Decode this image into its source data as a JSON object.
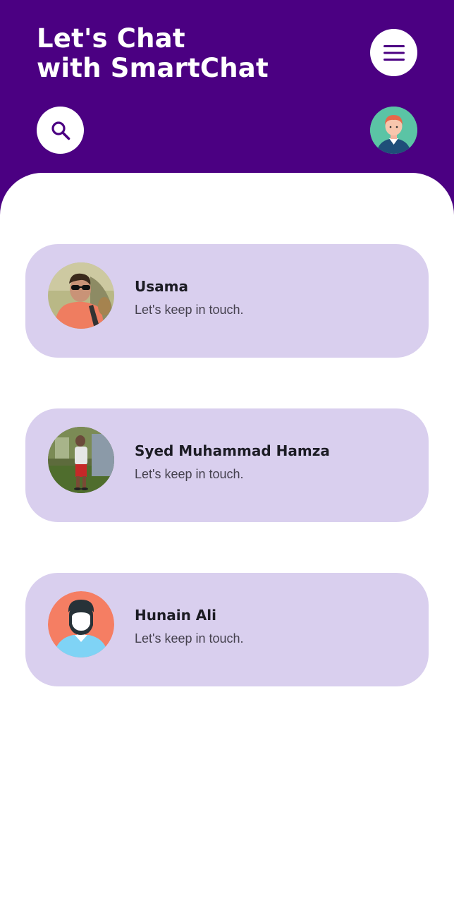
{
  "header": {
    "title_line1": "Let's Chat",
    "title_line2": "with SmartChat",
    "background_color": "#4b0082",
    "menu_icon": "hamburger-menu-icon",
    "search_icon": "search-icon",
    "profile_avatar": "avatar-icon"
  },
  "chats": [
    {
      "name": "Usama",
      "message": "Let's keep in touch.",
      "avatar": "photo"
    },
    {
      "name": "Syed Muhammad Hamza",
      "message": "Let's keep in touch.",
      "avatar": "photo"
    },
    {
      "name": "Hunain Ali",
      "message": "Let's keep in touch.",
      "avatar": "illustration"
    }
  ],
  "colors": {
    "card_bg": "#d9cfee",
    "icon_color": "#4b0082"
  }
}
